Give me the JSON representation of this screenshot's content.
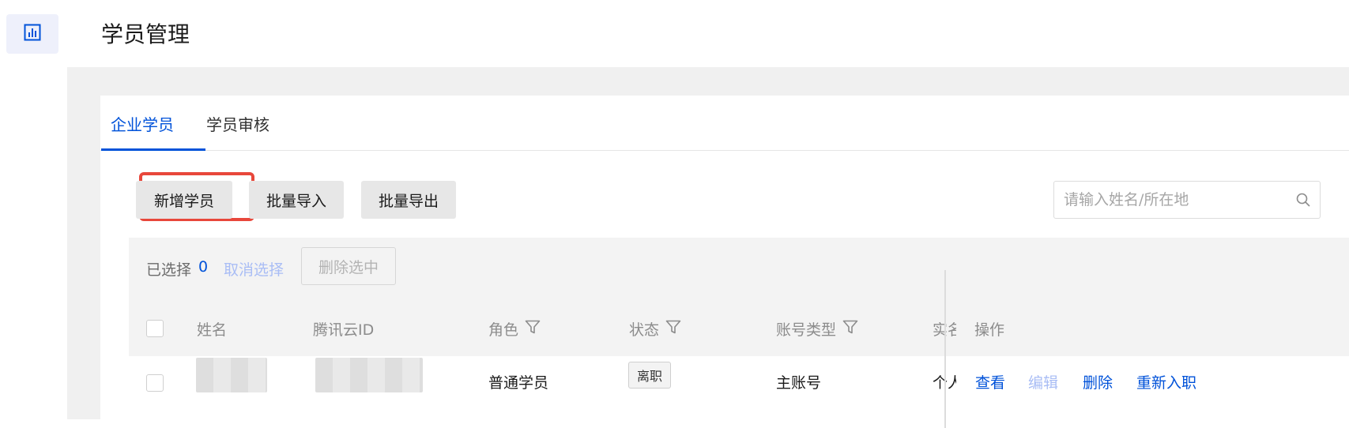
{
  "header": {
    "title": "学员管理"
  },
  "rail": {
    "icon": "bar-chart-icon",
    "accent": "#0052d9"
  },
  "tabs": [
    {
      "label": "企业学员",
      "active": true
    },
    {
      "label": "学员审核",
      "active": false
    }
  ],
  "toolbar": {
    "add_label": "新增学员",
    "import_label": "批量导入",
    "export_label": "批量导出",
    "search_placeholder": "请输入姓名/所在地"
  },
  "selection": {
    "label": "已选择",
    "count": "0",
    "cancel_label": "取消选择",
    "delete_label": "删除选中"
  },
  "table": {
    "columns": [
      "姓名",
      "腾讯云ID",
      "角色",
      "状态",
      "账号类型",
      "实名",
      "操作"
    ],
    "rows": [
      {
        "role": "普通学员",
        "status": "离职",
        "account_type": "主账号",
        "realname": "个人",
        "actions": [
          "查看",
          "编辑",
          "删除",
          "重新入职"
        ]
      }
    ]
  },
  "colors": {
    "accent": "#0052d9",
    "highlight": "#e8473b"
  }
}
